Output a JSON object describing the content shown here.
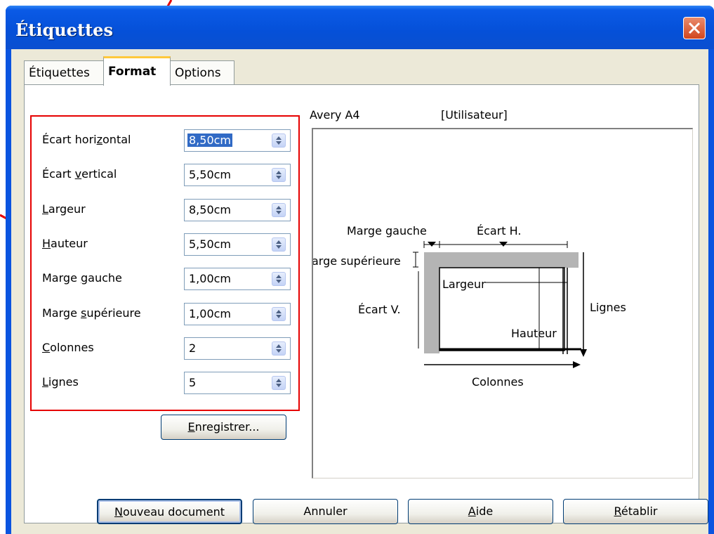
{
  "window": {
    "title": "Étiquettes"
  },
  "tabs": [
    {
      "label": "Étiquettes"
    },
    {
      "label": "Format"
    },
    {
      "label": "Options"
    }
  ],
  "fields": [
    {
      "label_pre": "Écart hori",
      "label_ul": "z",
      "label_post": "ontal",
      "value": "8,50cm"
    },
    {
      "label_pre": "Écart ",
      "label_ul": "v",
      "label_post": "ertical",
      "value": "5,50cm"
    },
    {
      "label_pre": "",
      "label_ul": "L",
      "label_post": "argeur",
      "value": "8,50cm"
    },
    {
      "label_pre": "",
      "label_ul": "H",
      "label_post": "auteur",
      "value": "5,50cm"
    },
    {
      "label_pre": "Marge ",
      "label_ul": "g",
      "label_post": "auche",
      "value": "1,00cm"
    },
    {
      "label_pre": "Marge ",
      "label_ul": "s",
      "label_post": "upérieure",
      "value": "1,00cm"
    },
    {
      "label_pre": "",
      "label_ul": "C",
      "label_post": "olonnes",
      "value": "2"
    },
    {
      "label_pre": "",
      "label_ul": "L",
      "label_post": "ignes",
      "value": "5"
    }
  ],
  "save_button": {
    "ul": "E",
    "rest": "nregistrer..."
  },
  "preview": {
    "brand": "Avery A4",
    "type": "[Utilisateur]",
    "labels": {
      "left_margin": "Marge gauche",
      "h_gap": "Écart H.",
      "top_margin": "arge supérieure",
      "width": "Largeur",
      "v_gap": "Écart V.",
      "rows": "Lignes",
      "height": "Hauteur",
      "columns": "Colonnes"
    }
  },
  "footer_buttons": [
    {
      "ul": "N",
      "rest": "ouveau document"
    },
    {
      "ul": "",
      "rest": "Annuler"
    },
    {
      "ul": "A",
      "rest": "ide"
    },
    {
      "ul": "R",
      "rest": "établir"
    }
  ],
  "colors": {
    "annotation": "#e60000",
    "titlebar": "#0550d8",
    "dialog_bg": "#ece9d8"
  }
}
